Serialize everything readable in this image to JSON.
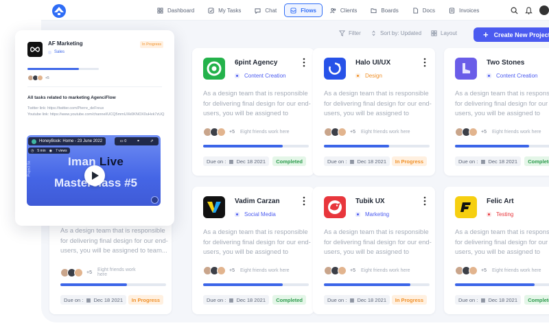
{
  "nav": {
    "items": [
      {
        "label": "Dashboard",
        "icon": "grid-icon",
        "active": false
      },
      {
        "label": "My Tasks",
        "icon": "checkbox-icon",
        "active": false
      },
      {
        "label": "Chat",
        "icon": "chat-icon",
        "active": false
      },
      {
        "label": "Flows",
        "icon": "inbox-icon",
        "active": true
      },
      {
        "label": "Clients",
        "icon": "users-icon",
        "active": false
      },
      {
        "label": "Boards",
        "icon": "folder-icon",
        "active": false
      },
      {
        "label": "Docs",
        "icon": "document-icon",
        "active": false
      },
      {
        "label": "Invoices",
        "icon": "invoice-icon",
        "active": false
      }
    ]
  },
  "toolbar": {
    "filter_label": "Filter",
    "sort_label": "Sort by: Updated",
    "layout_label": "Layout",
    "create_label": "Create New Project"
  },
  "colors": {
    "accent": "#2f6df6",
    "create_button": "#4b5bf0",
    "progress": "#3b65e8",
    "completed": "#2d9b4d",
    "in_progress": "#f0912a"
  },
  "cards": [
    {
      "name": "6pint Agency",
      "tag": "Content Creation",
      "tag_color": "#4b5bf0",
      "logo_icon": "target-icon",
      "logo_bg": "#24b24b",
      "desc": "As a design team that is responsible for delivering final design for our end-users, you will be assigned to",
      "faces_count": "+5",
      "faces_label": "Eight friends work here",
      "progress": 0.75,
      "due_label": "Due on :",
      "due_date": "Dec 18 2021",
      "status": "Completed"
    },
    {
      "name": "Halo UI/UX",
      "tag": "Design",
      "tag_color": "#f0912a",
      "logo_icon": "halo-icon",
      "logo_bg": "#2752e8",
      "desc": "As a design team that is responsible for delivering final design for our end-users, you will be assigned to",
      "faces_count": "+5",
      "faces_label": "Eight friends work here",
      "progress": 0.62,
      "due_label": "Due on :",
      "due_date": "Dec 18 2021",
      "status": "In Progress"
    },
    {
      "name": "Two Stones",
      "tag": "Content Creation",
      "tag_color": "#4b5bf0",
      "logo_icon": "boot-icon",
      "logo_bg": "#6a5de8",
      "desc": "As a design team that is responsible for delivering final design for our end-users, you will be assigned to",
      "faces_count": "+5",
      "faces_label": "Eight friends work here",
      "progress": 0.7,
      "due_label": "Due on :",
      "due_date": "Dec 18 2021",
      "status": "Completed"
    },
    {
      "name": "Vadim Carzan",
      "tag": "Social Media",
      "tag_color": "#4b5bf0",
      "logo_icon": "v-icon",
      "logo_bg": "#111111",
      "desc": "As a design team that is responsible for delivering final design for our end-users, you will be assigned to",
      "faces_count": "+5",
      "faces_label": "Eight friends work here",
      "progress": 0.75,
      "due_label": "Due on :",
      "due_date": "Dec 18 2021",
      "status": "Completed"
    },
    {
      "name": "Tubik UX",
      "tag": "Marketing",
      "tag_color": "#4b5bf0",
      "logo_icon": "bird-icon",
      "logo_bg": "#e8363c",
      "desc": "As a design team that is responsible for delivering final design for our end-users, you will be assigned to",
      "faces_count": "+5",
      "faces_label": "Eight friends work here",
      "progress": 0.82,
      "due_label": "Due on :",
      "due_date": "Dec 18 2021",
      "status": "In Progress"
    },
    {
      "name": "Felic Art",
      "tag": "Testing",
      "tag_color": "#e8363c",
      "logo_icon": "f-icon",
      "logo_bg": "#f6cf10",
      "desc": "As a design team that is responsible for delivering final design for our end-users, you will be assigned to",
      "faces_count": "+5",
      "faces_label": "Eight friends work here",
      "progress": 0.75,
      "due_label": "Due on :",
      "due_date": "Dec 18 2021",
      "status": "Completed"
    }
  ],
  "hidden_card": {
    "desc": "As a design team that is responsible for delivering final design for our end-users, you will be assigned to team...",
    "faces_count": "+5",
    "faces_label": "Eight friends work here",
    "progress": 0.63,
    "due_label": "Due on :",
    "due_date": "Dec 18 2021",
    "status": "In Progress"
  },
  "float_card": {
    "title": "AF Marketing",
    "subtitle": "Sales",
    "badge": "In Progress",
    "progress": 0.72,
    "faces_count": "+5",
    "heading": "All tasks related to marketing AgenciFlow",
    "links": "Twitter link: https://twitter.com/Pierre_deFreux\nYoutube link: https://www.youtube.com/channel/UCQ5mmUXk0KNOX0uHvk7zUQ",
    "video": {
      "bar_label": "HoneyBook: Home - 23 June 2022",
      "comment_count": "0",
      "duration": "5 min",
      "views": "7 views",
      "title_line1_a": "Iman",
      "title_line1_b": "Live",
      "title_line2": "Masterclass #5",
      "side_label": "Project Sa"
    }
  }
}
